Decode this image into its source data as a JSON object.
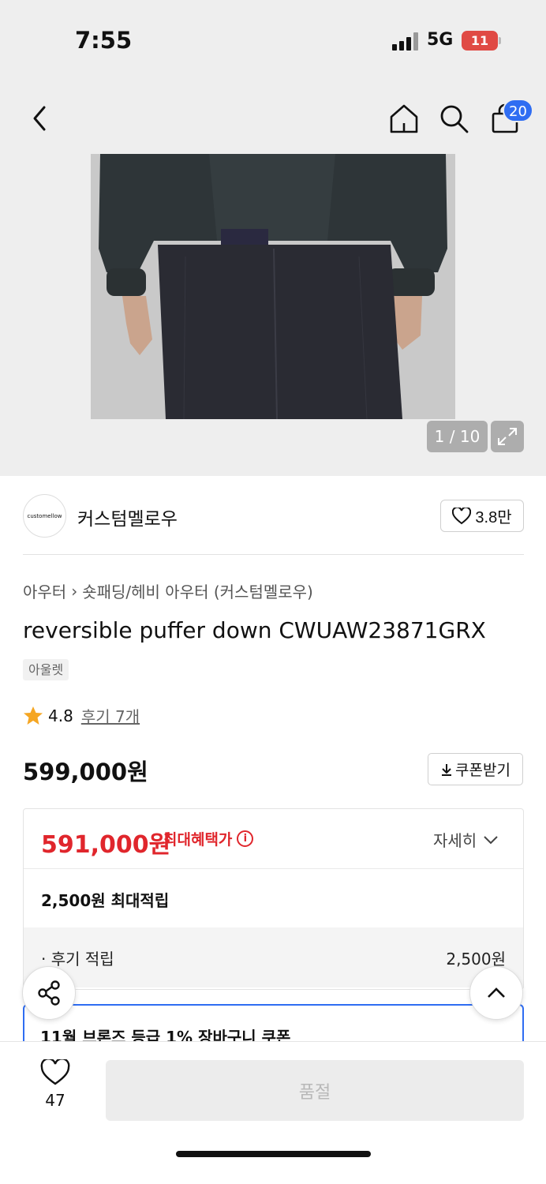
{
  "status_bar": {
    "time": "7:55",
    "network": "5G",
    "battery": "11"
  },
  "nav": {
    "back_icon": "chevron-left-icon",
    "home_icon": "home-icon",
    "search_icon": "search-icon",
    "cart_icon": "shopping-bag-icon",
    "cart_count": "20"
  },
  "gallery": {
    "pager": "1 / 10",
    "expand_icon": "expand-icon"
  },
  "brand": {
    "logo_text": "customellow",
    "name": "커스텀멜로우",
    "likes": "3.8만"
  },
  "product": {
    "breadcrumb": [
      "아우터",
      "숏패딩/헤비 아우터 (커스텀멜로우)"
    ],
    "name": "reversible puffer down CWUAW23871GRX",
    "tag": "아울렛",
    "rating": "4.8",
    "review_link": "후기 7개",
    "price": "599,000원",
    "coupon_button": "쿠폰받기"
  },
  "benefit": {
    "sale_price": "591,000원",
    "max_benefit_label": "최대혜택가",
    "detail_toggle": "자세히",
    "points": "2,500원 최대적립",
    "review_points_label": "· 후기 적립",
    "review_points_value": "2,500원",
    "coupon_card": "11월 브론즈 등급 1% 장바구니 쿠폰"
  },
  "bottom": {
    "wish_count": "47",
    "soldout_label": "품절"
  },
  "colors": {
    "sale_red": "#e0262c",
    "accent_blue": "#2f6df2",
    "soldout_bg": "#ececec"
  }
}
